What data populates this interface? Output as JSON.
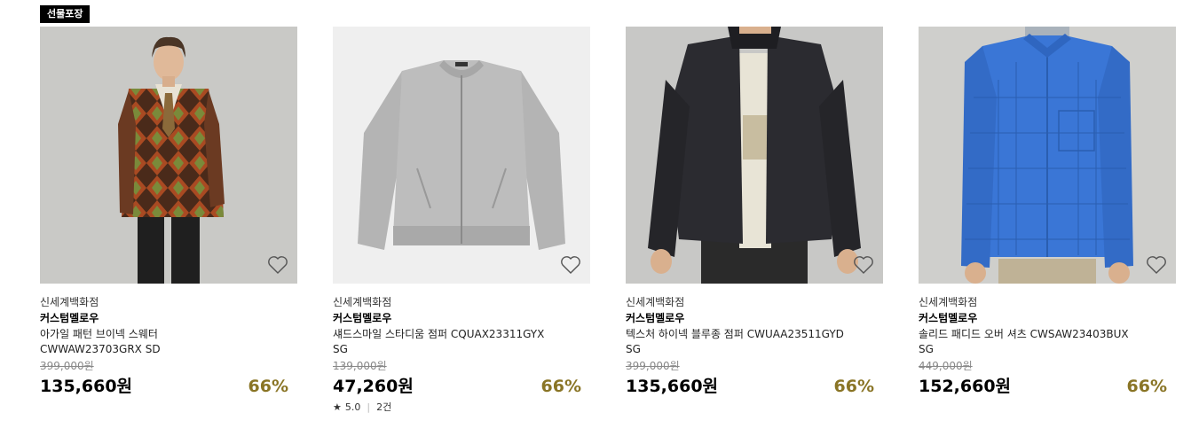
{
  "badge": "선물포장",
  "products": [
    {
      "store": "신세계백화점",
      "brand": "커스텀멜로우",
      "name_line1": "아가일 패턴 브이넥 스웨터",
      "name_line2": "CWWAW23703GRX SD",
      "original_price": "399,000원",
      "price": "135,660원",
      "discount": "66%",
      "image": "argyle-cardigan-model",
      "bg": "#c9c9c6"
    },
    {
      "store": "신세계백화점",
      "brand": "커스텀멜로우",
      "name_line1": "섀드스마일 스타디움 점퍼 CQUAX23311GYX",
      "name_line2": "SG",
      "original_price": "139,000원",
      "price": "47,260원",
      "discount": "66%",
      "rating": "5.0",
      "review_count": "2건",
      "image": "grey-zip-jacket",
      "bg": "#efefef"
    },
    {
      "store": "신세계백화점",
      "brand": "커스텀멜로우",
      "name_line1": "텍스처 하이넥 블루종 점퍼 CWUAA23511GYD",
      "name_line2": "SG",
      "original_price": "399,000원",
      "price": "135,660원",
      "discount": "66%",
      "image": "black-blouson-model",
      "bg": "#c8c8c6"
    },
    {
      "store": "신세계백화점",
      "brand": "커스텀멜로우",
      "name_line1": "솔리드 패디드 오버 셔츠 CWSAW23403BUX",
      "name_line2": "SG",
      "original_price": "449,000원",
      "price": "152,660원",
      "discount": "66%",
      "image": "blue-padded-shirt-model",
      "bg": "#cfcfcc"
    }
  ]
}
